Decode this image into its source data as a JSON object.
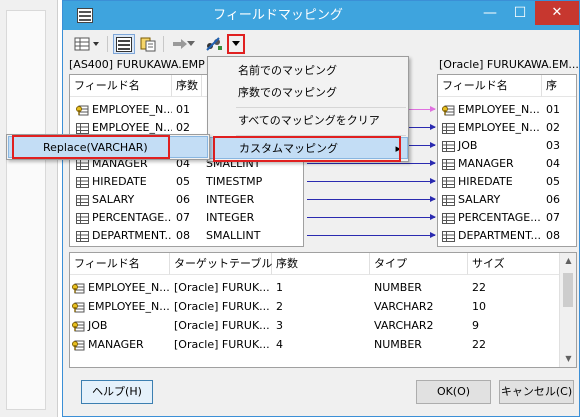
{
  "window": {
    "title": "フィールドマッピング",
    "minimize": "—",
    "maximize": "☐",
    "close": "✕"
  },
  "toolbar": {
    "icons": [
      "grid-dropdown-icon",
      "mapping-view-icon",
      "copy-icon",
      "arrow-right-icon",
      "auto-map-icon",
      "dropdown-arrow-icon"
    ]
  },
  "left_panel": {
    "header": "[AS400] FURUKAWA.EMP",
    "columns": [
      "フィールド名",
      "序数"
    ],
    "rows": [
      {
        "name": "EMPLOYEE_N...",
        "ord": "01",
        "type": "",
        "key": true
      },
      {
        "name": "EMPLOYEE_N...",
        "ord": "02",
        "type": "",
        "key": false
      },
      {
        "name": "",
        "ord": "",
        "type": "",
        "key": false
      },
      {
        "name": "MANAGER",
        "ord": "04",
        "type": "SMALLINT",
        "key": false
      },
      {
        "name": "HIREDATE",
        "ord": "05",
        "type": "TIMESTMP",
        "key": false
      },
      {
        "name": "SALARY",
        "ord": "06",
        "type": "INTEGER",
        "key": false
      },
      {
        "name": "PERCENTAGE...",
        "ord": "07",
        "type": "INTEGER",
        "key": false
      },
      {
        "name": "DEPARTMENT...",
        "ord": "08",
        "type": "SMALLINT",
        "key": false
      }
    ]
  },
  "right_panel": {
    "header": "[Oracle] FURUKAWA.EM...",
    "columns": [
      "フィールド名",
      "序"
    ],
    "rows": [
      {
        "name": "EMPLOYEE_N...",
        "ord": "01",
        "key": true
      },
      {
        "name": "EMPLOYEE_N...",
        "ord": "02",
        "key": false
      },
      {
        "name": "JOB",
        "ord": "03",
        "key": false
      },
      {
        "name": "MANAGER",
        "ord": "04",
        "key": false
      },
      {
        "name": "HIREDATE",
        "ord": "05",
        "key": false
      },
      {
        "name": "SALARY",
        "ord": "06",
        "key": false
      },
      {
        "name": "PERCENTAGE...",
        "ord": "07",
        "key": false
      },
      {
        "name": "DEPARTMENT...",
        "ord": "08",
        "key": false
      }
    ]
  },
  "dropdown_menu": {
    "items": [
      "名前でのマッピング",
      "序数でのマッピング",
      "すべてのマッピングをクリア",
      "カスタムマッピング"
    ],
    "submenu_arrow": "▸"
  },
  "submenu": {
    "items": [
      "Replace(VARCHAR)"
    ]
  },
  "bottom_table": {
    "columns": [
      "フィールド名",
      "ターゲットテーブル",
      "序数",
      "タイプ",
      "サイズ"
    ],
    "rows": [
      {
        "name": "EMPLOYEE_N...",
        "target": "[Oracle] FURUK...",
        "ord": "1",
        "type": "NUMBER",
        "size": "22",
        "key": true
      },
      {
        "name": "EMPLOYEE_N...",
        "target": "[Oracle] FURUK...",
        "ord": "2",
        "type": "VARCHAR2",
        "size": "10",
        "key": true
      },
      {
        "name": "JOB",
        "target": "[Oracle] FURUK...",
        "ord": "3",
        "type": "VARCHAR2",
        "size": "9",
        "key": true
      },
      {
        "name": "MANAGER",
        "target": "[Oracle] FURUK...",
        "ord": "4",
        "type": "NUMBER",
        "size": "22",
        "key": true
      }
    ]
  },
  "buttons": {
    "help": "ヘルプ(H)",
    "ok": "OK(O)",
    "cancel": "キャンセル(C)"
  },
  "colors": {
    "titlebar": "#3ea4de",
    "close": "#c7372f",
    "highlight_box": "#e02020",
    "connector": "#2a2ab0",
    "connector_selected": "#e070e0"
  }
}
